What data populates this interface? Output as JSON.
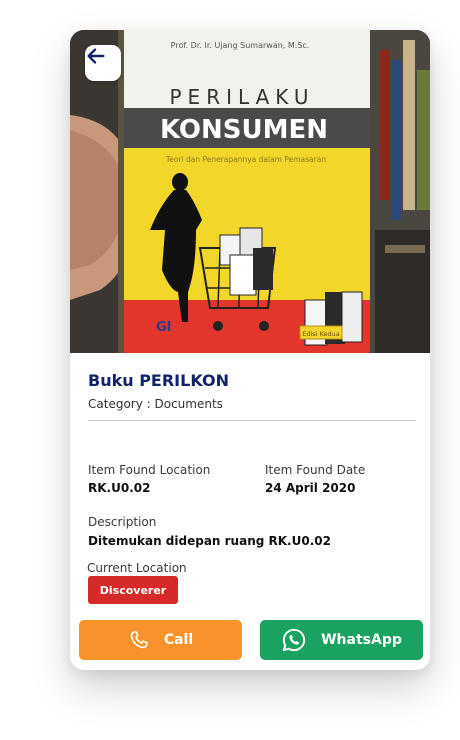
{
  "cover": {
    "author": "Prof. Dr. Ir. Ujang Sumarwan, M.Sc.",
    "title_line1": "PERILAKU",
    "title_line2": "KONSUMEN",
    "subtitle": "Teori dan Penerapannya dalam Pemasaran",
    "publisher": "GI",
    "edition": "Edisi Kedua"
  },
  "item": {
    "title": "Buku PERILKON",
    "category": "Category : Documents"
  },
  "details": {
    "found_location_label": "Item Found Location",
    "found_location_value": "RK.U0.02",
    "found_date_label": "Item Found Date",
    "found_date_value": "24 April 2020",
    "description_label": "Description",
    "description_value": "Ditemukan didepan ruang RK.U0.02",
    "current_location_label": "Current Location",
    "current_location_value": "Discoverer"
  },
  "actions": {
    "call_label": "Call",
    "whatsapp_label": "WhatsApp"
  },
  "colors": {
    "title": "#12236b",
    "badge": "#d62a2a",
    "call": "#f7932a",
    "whatsapp": "#1aa260"
  },
  "icons": {
    "back": "arrow-left-icon",
    "call": "phone-icon",
    "whatsapp": "whatsapp-icon"
  }
}
